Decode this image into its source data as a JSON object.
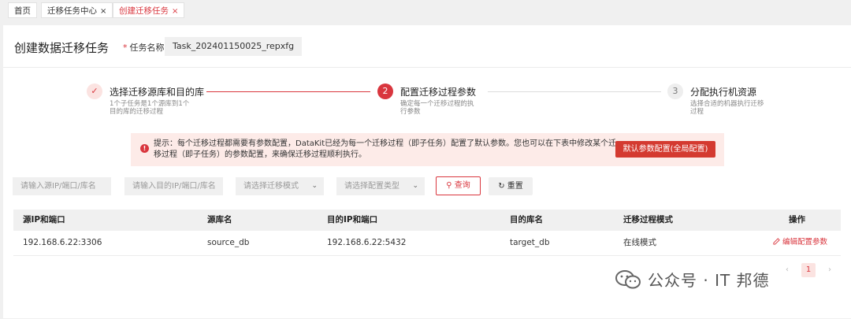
{
  "tabs": [
    {
      "label": "首页",
      "closable": false
    },
    {
      "label": "迁移任务中心",
      "closable": true
    },
    {
      "label": "创建迁移任务",
      "closable": true,
      "active": true
    }
  ],
  "close_glyph": "×",
  "page": {
    "title": "创建数据迁移任务",
    "task_name_label": "任务名称",
    "required_mark": "*",
    "task_name_value": "Task_202401150025_repxfg"
  },
  "steps": [
    {
      "icon": "✓",
      "title": "选择迁移源库和目的库",
      "desc1": "1个子任务是1个源库到1个",
      "desc2": "目的库的迁移过程",
      "state": "done"
    },
    {
      "icon": "2",
      "title": "配置迁移过程参数",
      "desc1": "确定每一个迁移过程的执",
      "desc2": "行参数",
      "state": "current"
    },
    {
      "icon": "3",
      "title": "分配执行机资源",
      "desc1": "选择合适的机器执行迁移",
      "desc2": "过程",
      "state": "wait"
    }
  ],
  "alert": {
    "icon": "!",
    "text": "提示：每个迁移过程都需要有参数配置，DataKit已经为每一个迁移过程（即子任务）配置了默认参数。您也可以在下表中修改某个迁移过程（即子任务）的参数配置，来确保迁移过程顺利执行。",
    "button": "默认参数配置(全局配置)"
  },
  "filters": {
    "src_placeholder": "请输入源IP/端口/库名",
    "dst_placeholder": "请输入目的IP/端口/库名",
    "mode_placeholder": "请选择迁移模式",
    "config_placeholder": "请选择配置类型",
    "chevron": "⌄",
    "query": "查询",
    "reset": "重置",
    "search_glyph": "⚲",
    "reset_glyph": "↻"
  },
  "table": {
    "headers": [
      "源IP和端口",
      "源库名",
      "目的IP和端口",
      "目的库名",
      "迁移过程模式",
      "操作"
    ],
    "rows": [
      {
        "src": "192.168.6.22:3306",
        "src_db": "source_db",
        "dst": "192.168.6.22:5432",
        "dst_db": "target_db",
        "mode": "在线模式",
        "action": "编辑配置参数"
      }
    ]
  },
  "pagination": {
    "prev": "‹",
    "current": "1",
    "next": "›"
  },
  "watermark": {
    "text": "公众号 · IT 邦德"
  },
  "colors": {
    "accent": "#d9363e",
    "alert_bg": "#fdebe8",
    "header_bg": "#f0f0f0"
  }
}
